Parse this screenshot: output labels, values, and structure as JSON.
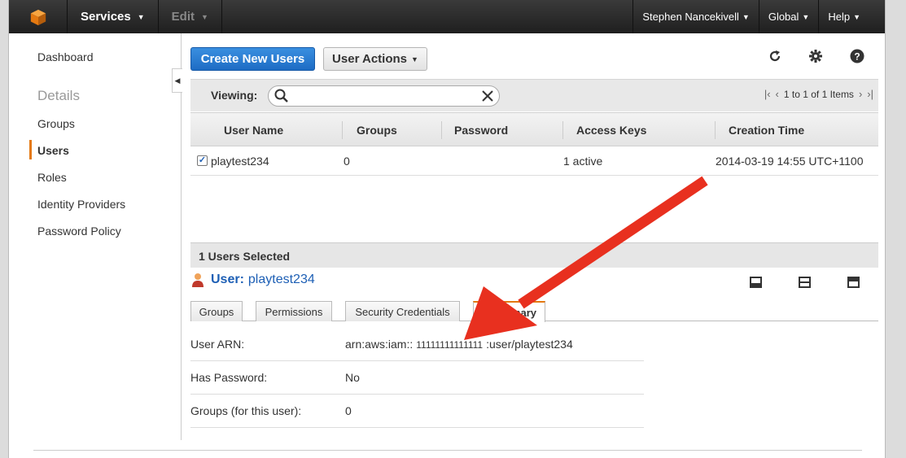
{
  "topbar": {
    "services": "Services",
    "edit": "Edit",
    "user": "Stephen Nancekivell",
    "region": "Global",
    "help": "Help"
  },
  "sidebar": {
    "dashboard": "Dashboard",
    "heading": "Details",
    "items": [
      "Groups",
      "Users",
      "Roles",
      "Identity Providers",
      "Password Policy"
    ],
    "active": "Users"
  },
  "toolbar": {
    "create_label": "Create New Users",
    "actions_label": "User Actions"
  },
  "viewing": {
    "label": "Viewing:",
    "search_value": "",
    "pager_text": "1 to 1 of 1 Items"
  },
  "table": {
    "columns": [
      "User Name",
      "Groups",
      "Password",
      "Access Keys",
      "Creation Time"
    ],
    "rows": [
      {
        "user_name": "playtest234",
        "groups": "0",
        "password": "",
        "access_keys": "1 active",
        "creation_time": "2014-03-19 14:55 UTC+1100",
        "checked": true
      }
    ]
  },
  "selection": {
    "count_text": "1 Users Selected",
    "user_label": "User:",
    "user_name": "playtest234"
  },
  "tabs": [
    "Groups",
    "Permissions",
    "Security Credentials",
    "Summary"
  ],
  "tab_visible_labels": {
    "summary_partial": "mmary"
  },
  "summary": {
    "arn_label": "User ARN:",
    "arn_prefix": "arn:aws:iam::",
    "arn_account": "11111111111111",
    "arn_suffix": ":user/playtest234",
    "has_password_label": "Has Password:",
    "has_password_value": "No",
    "groups_label": "Groups (for this user):",
    "groups_value": "0"
  },
  "colors": {
    "accent_orange": "#e47911",
    "primary_blue": "#1d6cc4",
    "arrow_red": "#e8301f"
  }
}
